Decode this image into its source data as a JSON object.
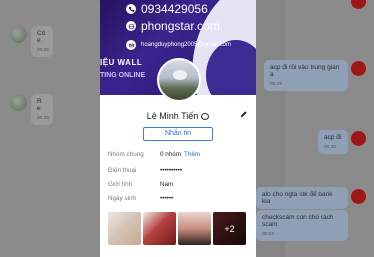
{
  "left_chat": [
    {
      "text": "Có e",
      "time": "00:36"
    },
    {
      "text": "R e",
      "time": "00:36"
    }
  ],
  "right_chat": [
    {
      "text": "acp đi rồi vào trung gian a",
      "time": "00:39"
    },
    {
      "text": "acp đi",
      "time": "00:40"
    },
    {
      "text": "alo cho ngta stk để bank kia",
      "time": ""
    },
    {
      "text": "checkscam con chó rách scam",
      "time": "00:52"
    }
  ],
  "profile": {
    "cover_phone": "0934429056",
    "cover_site": "phongstar.com",
    "cover_email": "hoangduyphong2005@gmail.com",
    "cover_ribbon": "IỆU WALL",
    "cover_ribbon2": "TING ONLINE",
    "name": "Lê Minh Tiến",
    "message_button": "Nhắn tin",
    "rows": {
      "groups_label": "Nhóm chung",
      "groups_value": "0 nhóm",
      "groups_action": "Thêm",
      "phone_label": "Điện thoại",
      "phone_value": "••••••••••",
      "gender_label": "Giới tính",
      "gender_value": "Nam",
      "birthday_label": "Ngày sinh",
      "birthday_value": "••••••"
    },
    "photos_more": "+2"
  },
  "colors": {
    "link": "#2b6ed6",
    "accent_red": "#a11616"
  }
}
